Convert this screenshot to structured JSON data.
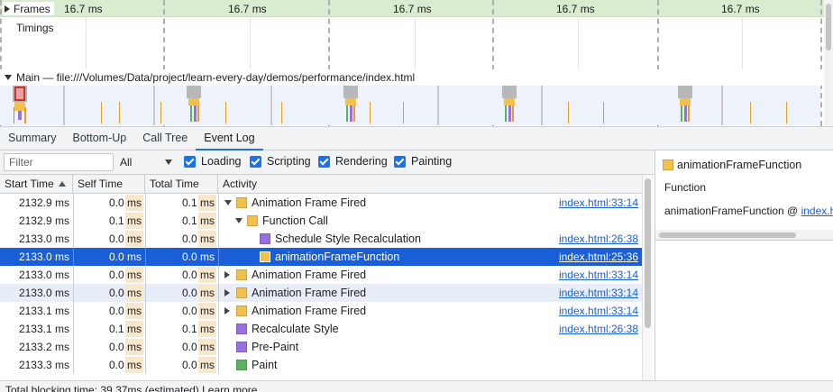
{
  "overview": {
    "frames_label": "Frames",
    "frame_durations": [
      "16.7 ms",
      "16.7 ms",
      "16.7 ms",
      "16.7 ms",
      "16.7 ms"
    ],
    "timings_label": "Timings",
    "main_thread_label": "Main — file:///Volumes/Data/project/learn-every-day/demos/performance/index.html"
  },
  "tabs": [
    {
      "label": "Summary",
      "active": false
    },
    {
      "label": "Bottom-Up",
      "active": false
    },
    {
      "label": "Call Tree",
      "active": false
    },
    {
      "label": "Event Log",
      "active": true
    }
  ],
  "toolbar": {
    "filter_placeholder": "Filter",
    "duration_value": "All",
    "checkboxes": [
      {
        "label": "Loading",
        "checked": true
      },
      {
        "label": "Scripting",
        "checked": true
      },
      {
        "label": "Rendering",
        "checked": true
      },
      {
        "label": "Painting",
        "checked": true
      }
    ]
  },
  "table": {
    "headers": {
      "start_time": "Start Time",
      "self_time": "Self Time",
      "total_time": "Total Time",
      "activity": "Activity"
    },
    "rows": [
      {
        "start": "2132.9 ms",
        "self": "0.0 ms",
        "total": "0.1 ms",
        "activity": "Animation Frame Fired",
        "category": "scripting",
        "expander": "down",
        "depth": 0,
        "link": "index.html:33:14"
      },
      {
        "start": "2132.9 ms",
        "self": "0.1 ms",
        "total": "0.1 ms",
        "activity": "Function Call",
        "category": "scripting",
        "expander": "down",
        "depth": 1,
        "link": ""
      },
      {
        "start": "2133.0 ms",
        "self": "0.0 ms",
        "total": "0.0 ms",
        "activity": "Schedule Style Recalculation",
        "category": "rendering",
        "expander": "none",
        "depth": 2,
        "link": "index.html:26:38"
      },
      {
        "start": "2133.0 ms",
        "self": "0.0 ms",
        "total": "0.0 ms",
        "activity": "animationFrameFunction",
        "category": "scripting",
        "expander": "none",
        "depth": 2,
        "link": "index.html:25:36",
        "selected": true
      },
      {
        "start": "2133.0 ms",
        "self": "0.0 ms",
        "total": "0.0 ms",
        "activity": "Animation Frame Fired",
        "category": "scripting",
        "expander": "right",
        "depth": 0,
        "link": "index.html:33:14"
      },
      {
        "start": "2133.0 ms",
        "self": "0.0 ms",
        "total": "0.0 ms",
        "activity": "Animation Frame Fired",
        "category": "scripting",
        "expander": "right",
        "depth": 0,
        "link": "index.html:33:14",
        "hovered": true
      },
      {
        "start": "2133.1 ms",
        "self": "0.0 ms",
        "total": "0.0 ms",
        "activity": "Animation Frame Fired",
        "category": "scripting",
        "expander": "right",
        "depth": 0,
        "link": "index.html:33:14"
      },
      {
        "start": "2133.1 ms",
        "self": "0.1 ms",
        "total": "0.1 ms",
        "activity": "Recalculate Style",
        "category": "rendering",
        "expander": "none",
        "depth": 0,
        "link": "index.html:26:38"
      },
      {
        "start": "2133.2 ms",
        "self": "0.0 ms",
        "total": "0.0 ms",
        "activity": "Pre-Paint",
        "category": "rendering",
        "expander": "none",
        "depth": 0,
        "link": ""
      },
      {
        "start": "2133.3 ms",
        "self": "0.0 ms",
        "total": "0.0 ms",
        "activity": "Paint",
        "category": "painting",
        "expander": "none",
        "depth": 0,
        "link": ""
      }
    ]
  },
  "category_colors": {
    "scripting": "#f2c04d",
    "rendering": "#9b6ee0",
    "painting": "#5bb260",
    "loading": "#5a94e8"
  },
  "details": {
    "title": "animationFrameFunction",
    "type": "Function",
    "function_prefix": "animationFrameFunction @ ",
    "function_link": "index.h"
  },
  "status_bar": {
    "text": "Total blocking time: 39.37ms (estimated)  Learn more"
  }
}
